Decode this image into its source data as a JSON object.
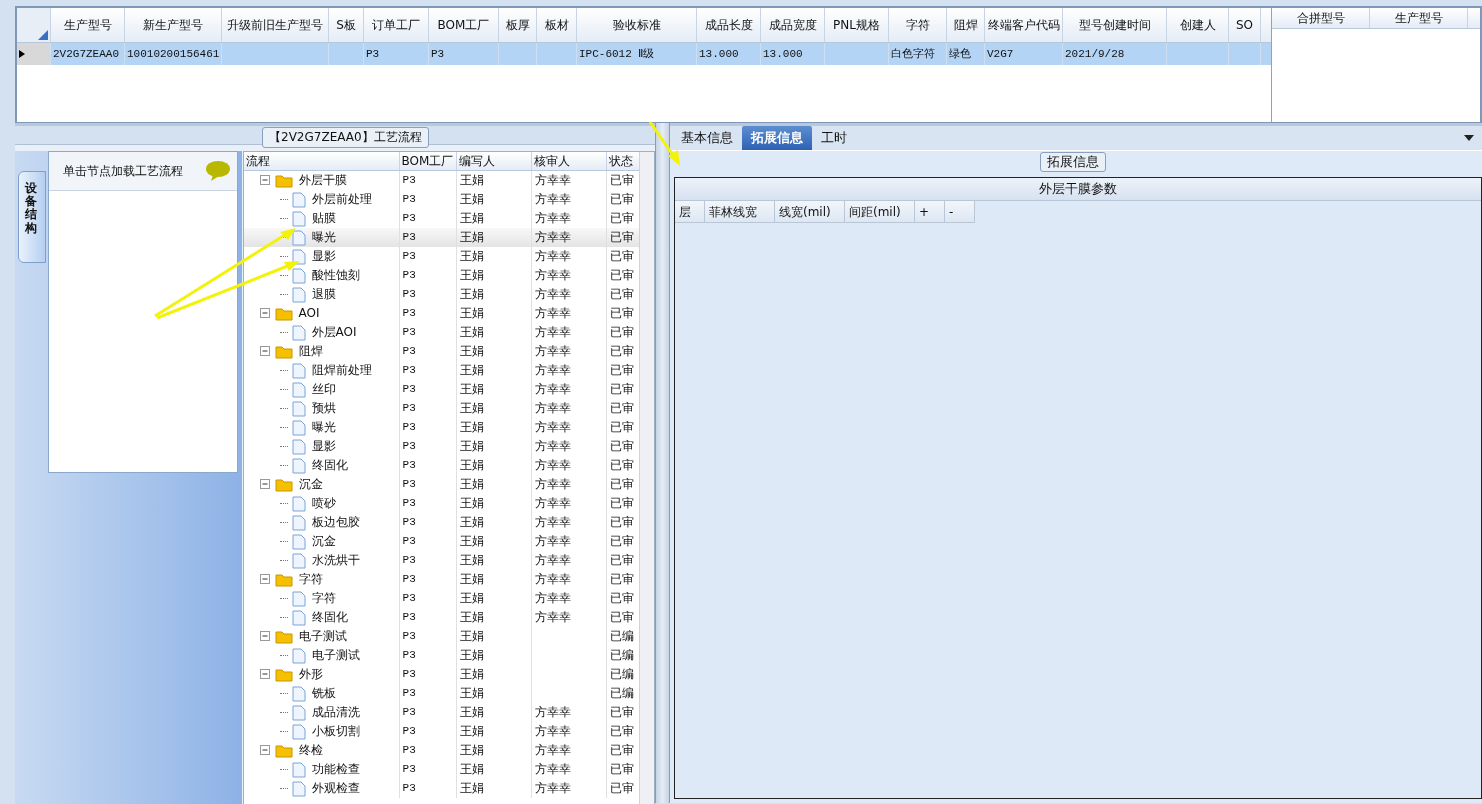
{
  "top_grid": {
    "columns": [
      "生产型号",
      "新生产型号",
      "升级前旧生产型号",
      "S板",
      "订单工厂",
      "BOM工厂",
      "板厚",
      "板材",
      "验收标准",
      "成品长度",
      "成品宽度",
      "PNL规格",
      "字符",
      "阻焊",
      "终端客户代码",
      "型号创建时间",
      "创建人",
      "SO"
    ],
    "rows": [
      {
        "selected": true,
        "cells": [
          "2V2G7ZEAA0",
          "10010200156461",
          "",
          "",
          "P3",
          "P3",
          "",
          "",
          "IPC-6012 Ⅱ级",
          "13.000",
          "13.000",
          "",
          "白色字符",
          "绿色",
          "V2G7",
          "2021/9/28",
          "",
          ""
        ]
      }
    ]
  },
  "merge_grid": {
    "columns": [
      "合拼型号",
      "生产型号"
    ]
  },
  "process_panel": {
    "title": "【2V2G7ZEAA0】工艺流程",
    "side_tab": "设备结构",
    "hint": "单击节点加载工艺流程",
    "tree": {
      "columns": [
        "流程",
        "BOM工厂",
        "编写人",
        "核审人",
        "状态"
      ],
      "nodes": [
        {
          "label": "外层干膜",
          "bom": "P3",
          "writer": "王娟",
          "reviewer": "方幸幸",
          "status": "已审",
          "selected": false,
          "expanded": true,
          "children": [
            {
              "label": "外层前处理",
              "bom": "P3",
              "writer": "王娟",
              "reviewer": "方幸幸",
              "status": "已审",
              "selected": false
            },
            {
              "label": "贴膜",
              "bom": "P3",
              "writer": "王娟",
              "reviewer": "方幸幸",
              "status": "已审",
              "selected": false
            },
            {
              "label": "曝光",
              "bom": "P3",
              "writer": "王娟",
              "reviewer": "方幸幸",
              "status": "已审",
              "selected": true
            },
            {
              "label": "显影",
              "bom": "P3",
              "writer": "王娟",
              "reviewer": "方幸幸",
              "status": "已审",
              "selected": false
            },
            {
              "label": "酸性蚀刻",
              "bom": "P3",
              "writer": "王娟",
              "reviewer": "方幸幸",
              "status": "已审",
              "selected": false
            },
            {
              "label": "退膜",
              "bom": "P3",
              "writer": "王娟",
              "reviewer": "方幸幸",
              "status": "已审",
              "selected": false
            }
          ]
        },
        {
          "label": "AOI",
          "bom": "P3",
          "writer": "王娟",
          "reviewer": "方幸幸",
          "status": "已审",
          "selected": false,
          "expanded": true,
          "children": [
            {
              "label": "外层AOI",
              "bom": "P3",
              "writer": "王娟",
              "reviewer": "方幸幸",
              "status": "已审",
              "selected": false
            }
          ]
        },
        {
          "label": "阻焊",
          "bom": "P3",
          "writer": "王娟",
          "reviewer": "方幸幸",
          "status": "已审",
          "selected": false,
          "expanded": true,
          "children": [
            {
              "label": "阻焊前处理",
              "bom": "P3",
              "writer": "王娟",
              "reviewer": "方幸幸",
              "status": "已审",
              "selected": false
            },
            {
              "label": "丝印",
              "bom": "P3",
              "writer": "王娟",
              "reviewer": "方幸幸",
              "status": "已审",
              "selected": false
            },
            {
              "label": "预烘",
              "bom": "P3",
              "writer": "王娟",
              "reviewer": "方幸幸",
              "status": "已审",
              "selected": false
            },
            {
              "label": "曝光",
              "bom": "P3",
              "writer": "王娟",
              "reviewer": "方幸幸",
              "status": "已审",
              "selected": false
            },
            {
              "label": "显影",
              "bom": "P3",
              "writer": "王娟",
              "reviewer": "方幸幸",
              "status": "已审",
              "selected": false
            },
            {
              "label": "终固化",
              "bom": "P3",
              "writer": "王娟",
              "reviewer": "方幸幸",
              "status": "已审",
              "selected": false
            }
          ]
        },
        {
          "label": "沉金",
          "bom": "P3",
          "writer": "王娟",
          "reviewer": "方幸幸",
          "status": "已审",
          "selected": false,
          "expanded": true,
          "children": [
            {
              "label": "喷砂",
              "bom": "P3",
              "writer": "王娟",
              "reviewer": "方幸幸",
              "status": "已审",
              "selected": false
            },
            {
              "label": "板边包胶",
              "bom": "P3",
              "writer": "王娟",
              "reviewer": "方幸幸",
              "status": "已审",
              "selected": false
            },
            {
              "label": "沉金",
              "bom": "P3",
              "writer": "王娟",
              "reviewer": "方幸幸",
              "status": "已审",
              "selected": false
            },
            {
              "label": "水洗烘干",
              "bom": "P3",
              "writer": "王娟",
              "reviewer": "方幸幸",
              "status": "已审",
              "selected": false
            }
          ]
        },
        {
          "label": "字符",
          "bom": "P3",
          "writer": "王娟",
          "reviewer": "方幸幸",
          "status": "已审",
          "selected": false,
          "expanded": true,
          "children": [
            {
              "label": "字符",
              "bom": "P3",
              "writer": "王娟",
              "reviewer": "方幸幸",
              "status": "已审",
              "selected": false
            },
            {
              "label": "终固化",
              "bom": "P3",
              "writer": "王娟",
              "reviewer": "方幸幸",
              "status": "已审",
              "selected": false
            }
          ]
        },
        {
          "label": "电子测试",
          "bom": "P3",
          "writer": "王娟",
          "status": "已编",
          "selected": false,
          "expanded": true,
          "children": [
            {
              "label": "电子测试",
              "bom": "P3",
              "writer": "王娟",
              "status": "已编",
              "selected": false
            }
          ]
        },
        {
          "label": "外形",
          "bom": "P3",
          "writer": "王娟",
          "status": "已编",
          "selected": false,
          "expanded": true,
          "children": [
            {
              "label": "铣板",
              "bom": "P3",
              "writer": "王娟",
              "status": "已编",
              "selected": false
            },
            {
              "label": "成品清洗",
              "bom": "P3",
              "writer": "王娟",
              "reviewer": "方幸幸",
              "status": "已审",
              "selected": false
            },
            {
              "label": "小板切割",
              "bom": "P3",
              "writer": "王娟",
              "reviewer": "方幸幸",
              "status": "已审",
              "selected": false
            }
          ]
        },
        {
          "label": "终检",
          "bom": "P3",
          "writer": "王娟",
          "reviewer": "方幸幸",
          "status": "已审",
          "selected": false,
          "expanded": true,
          "children": [
            {
              "label": "功能检查",
              "bom": "P3",
              "writer": "王娟",
              "reviewer": "方幸幸",
              "status": "已审",
              "selected": false
            },
            {
              "label": "外观检查",
              "bom": "P3",
              "writer": "王娟",
              "reviewer": "方幸幸",
              "status": "已审",
              "selected": false
            }
          ]
        }
      ]
    }
  },
  "detail_panel": {
    "tabs": [
      {
        "label": "基本信息",
        "selected": false
      },
      {
        "label": "拓展信息",
        "selected": true
      },
      {
        "label": "工时",
        "selected": false
      }
    ],
    "group_title": "拓展信息",
    "param_table": {
      "title": "外层干膜参数",
      "columns": [
        "层",
        "菲林线宽",
        "线宽(mil)",
        "间距(mil)",
        "+",
        "-"
      ]
    }
  }
}
